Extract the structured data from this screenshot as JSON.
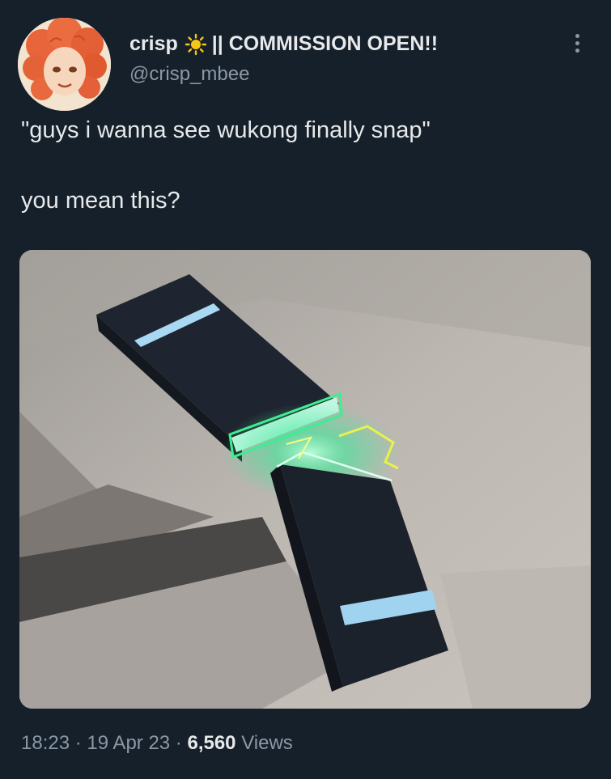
{
  "author": {
    "display_name": "crisp",
    "name_suffix": "|| COMMISSION OPEN!!",
    "handle": "@crisp_mbee",
    "avatar_icon": "avatar-image",
    "emoji_icon": "sun-icon"
  },
  "tweet": {
    "line1": "\"guys i wanna see wukong finally snap\"",
    "line2": "you mean this?",
    "media_description": "cartoon-staff-breaking-in-half"
  },
  "meta": {
    "time": "18:23",
    "separator1": " · ",
    "date": "19 Apr 23",
    "separator2": " · ",
    "views_count": "6,560",
    "views_label": " Views"
  },
  "colors": {
    "background": "#15202b",
    "text_primary": "#e7e9ea",
    "text_secondary": "#8b98a5",
    "sun": "#f5c518"
  }
}
